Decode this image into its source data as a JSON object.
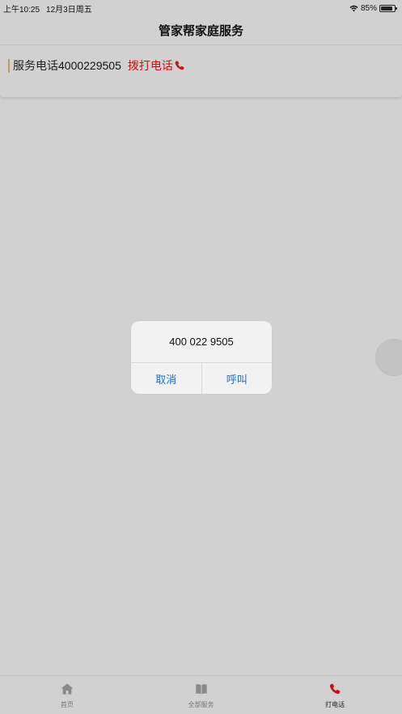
{
  "status_bar": {
    "time": "上午10:25",
    "date": "12月3日周五",
    "battery": "85%",
    "battery_level": 0.85
  },
  "nav": {
    "title": "管家帮家庭服务"
  },
  "service": {
    "label": "服务电话",
    "number": "4000229505",
    "call_label": "拨打电话",
    "call_icon": "phone-icon",
    "call_color": "#c81414",
    "accent_color": "#c99a5b"
  },
  "alert": {
    "message": "400 022 9505",
    "cancel_label": "取消",
    "call_label": "呼叫",
    "button_color": "#1a73d9"
  },
  "tabs": [
    {
      "label": "首页",
      "icon": "home-icon",
      "active": false
    },
    {
      "label": "全部服务",
      "icon": "book-icon",
      "active": false
    },
    {
      "label": "打电话",
      "icon": "phone-icon",
      "active": true
    }
  ]
}
